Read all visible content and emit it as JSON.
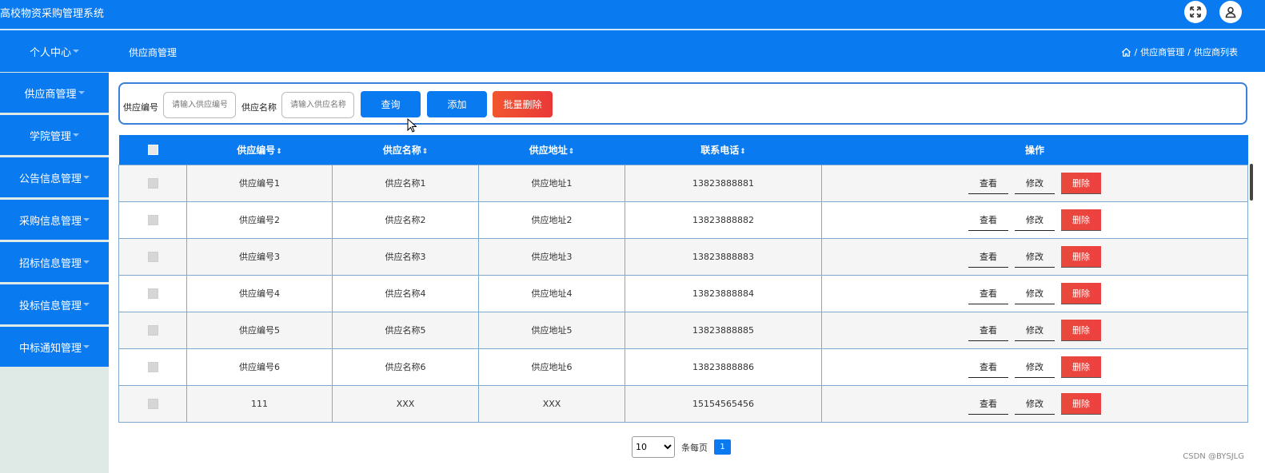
{
  "app": {
    "title": "高校物资采购管理系统"
  },
  "header": {
    "personal_center": "个人中心",
    "page_title": "供应商管理"
  },
  "breadcrumb": {
    "items": [
      "供应商管理",
      "供应商列表"
    ],
    "separator": "/"
  },
  "sidebar": {
    "items": [
      {
        "label": "供应商管理"
      },
      {
        "label": "学院管理"
      },
      {
        "label": "公告信息管理"
      },
      {
        "label": "采购信息管理"
      },
      {
        "label": "招标信息管理"
      },
      {
        "label": "投标信息管理"
      },
      {
        "label": "中标通知管理"
      }
    ]
  },
  "search": {
    "code_label": "供应编号",
    "code_placeholder": "请输入供应编号",
    "name_label": "供应名称",
    "name_placeholder": "请输入供应名称",
    "query_btn": "查询",
    "add_btn": "添加",
    "batch_delete_btn": "批量删除"
  },
  "table": {
    "columns": [
      "供应编号",
      "供应名称",
      "供应地址",
      "联系电话",
      "操作"
    ],
    "sort_icon": "⇕",
    "rows": [
      {
        "code": "供应编号1",
        "name": "供应名称1",
        "address": "供应地址1",
        "phone": "13823888881"
      },
      {
        "code": "供应编号2",
        "name": "供应名称2",
        "address": "供应地址2",
        "phone": "13823888882"
      },
      {
        "code": "供应编号3",
        "name": "供应名称3",
        "address": "供应地址3",
        "phone": "13823888883"
      },
      {
        "code": "供应编号4",
        "name": "供应名称4",
        "address": "供应地址4",
        "phone": "13823888884"
      },
      {
        "code": "供应编号5",
        "name": "供应名称5",
        "address": "供应地址5",
        "phone": "13823888885"
      },
      {
        "code": "供应编号6",
        "name": "供应名称6",
        "address": "供应地址6",
        "phone": "13823888886"
      },
      {
        "code": "111",
        "name": "XXX",
        "address": "XXX",
        "phone": "15154565456"
      }
    ],
    "actions": {
      "view": "查看",
      "edit": "修改",
      "delete": "删除"
    }
  },
  "pagination": {
    "page_size": "10",
    "page_size_options": [
      "10"
    ],
    "per_page_label": "条每页",
    "current_page": "1"
  },
  "watermark": "CSDN @BYSJLG",
  "colors": {
    "primary": "#0a7af0",
    "danger": "#ea3838",
    "sidebar_bg": "#dfe9e5"
  }
}
